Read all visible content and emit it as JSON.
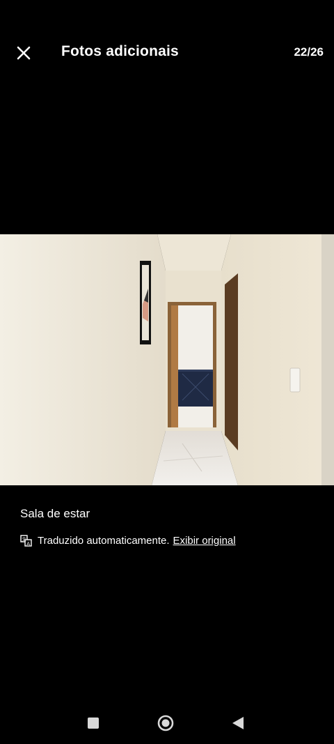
{
  "header": {
    "title": "Fotos adicionais",
    "counter": "22/26"
  },
  "photo": {
    "room": "Sala de estar"
  },
  "translation": {
    "notice": "Traduzido automaticamente.",
    "link": "Exibir original"
  },
  "icons": {
    "close": "close-icon",
    "translate": "translate-icon",
    "recents": "square-icon",
    "home": "circle-icon",
    "back": "triangle-back-icon"
  }
}
